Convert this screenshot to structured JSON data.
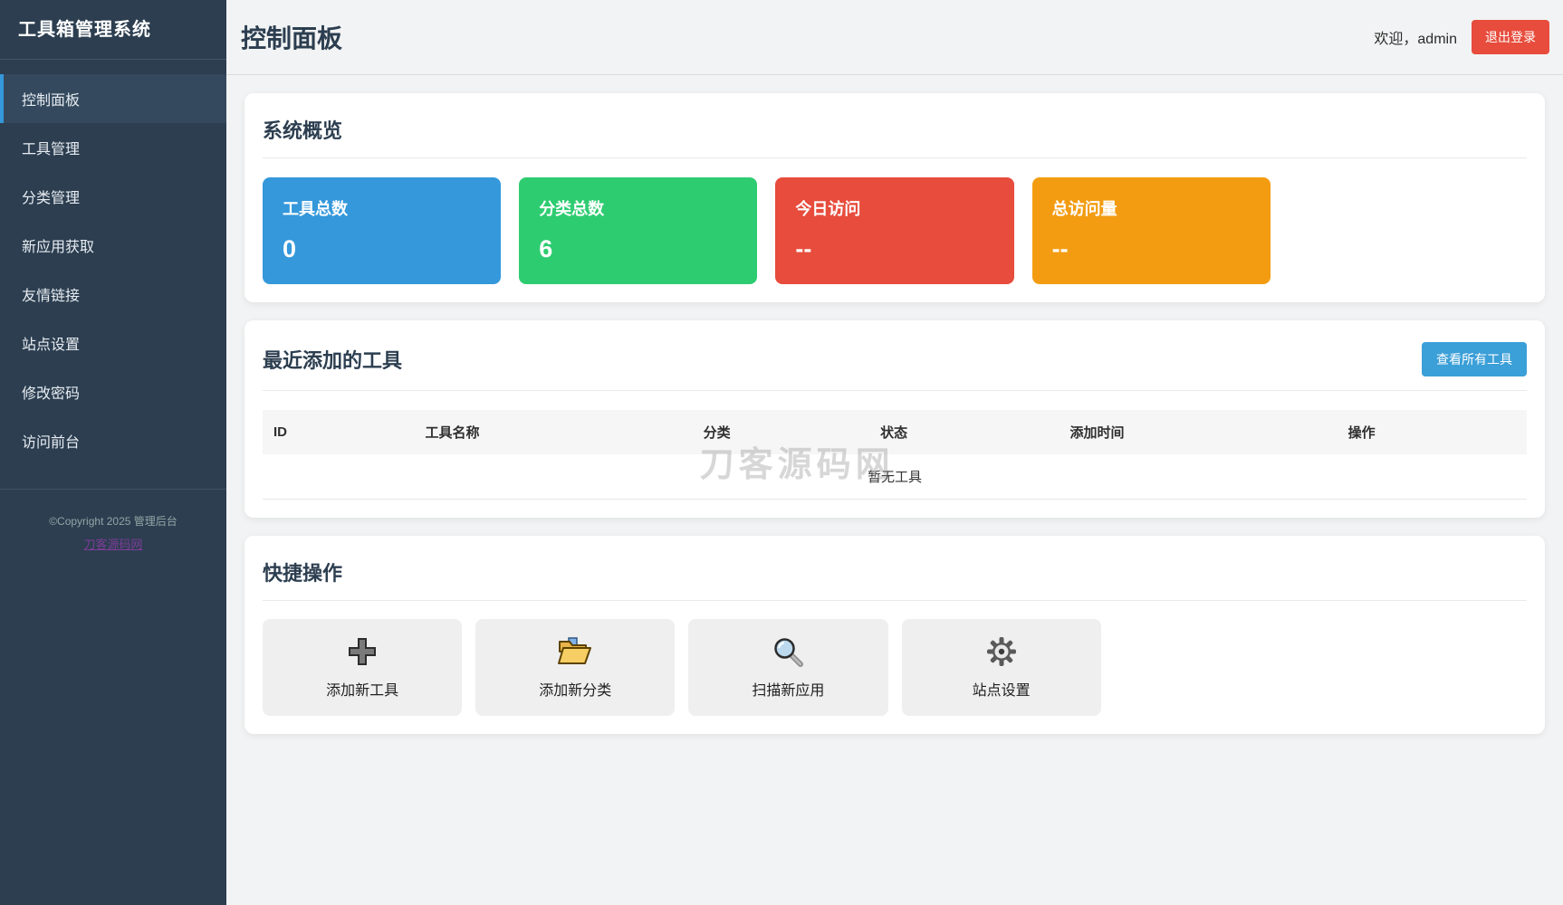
{
  "app": {
    "title": "工具箱管理系统"
  },
  "sidebar": {
    "items": [
      {
        "label": "控制面板",
        "active": true
      },
      {
        "label": "工具管理",
        "active": false
      },
      {
        "label": "分类管理",
        "active": false
      },
      {
        "label": "新应用获取",
        "active": false
      },
      {
        "label": "友情链接",
        "active": false
      },
      {
        "label": "站点设置",
        "active": false
      },
      {
        "label": "修改密码",
        "active": false
      },
      {
        "label": "访问前台",
        "active": false
      }
    ],
    "copyright": "©Copyright 2025 管理后台",
    "footer_link": "刀客源码网"
  },
  "header": {
    "page_title": "控制面板",
    "welcome": "欢迎，admin",
    "logout_label": "退出登录"
  },
  "overview": {
    "title": "系统概览",
    "cards": [
      {
        "label": "工具总数",
        "value": "0",
        "color": "#3498db"
      },
      {
        "label": "分类总数",
        "value": "6",
        "color": "#2ecc71"
      },
      {
        "label": "今日访问",
        "value": "--",
        "color": "#e74c3c"
      },
      {
        "label": "总访问量",
        "value": "--",
        "color": "#f39c12"
      }
    ]
  },
  "recent_tools": {
    "title": "最近添加的工具",
    "view_all_label": "查看所有工具",
    "columns": [
      "ID",
      "工具名称",
      "分类",
      "状态",
      "添加时间",
      "操作"
    ],
    "rows": [],
    "empty_text": "暂无工具"
  },
  "watermark": {
    "text": "刀客源码网"
  },
  "quick_actions": {
    "title": "快捷操作",
    "items": [
      {
        "icon": "plus-icon",
        "label": "添加新工具"
      },
      {
        "icon": "folder-icon",
        "label": "添加新分类"
      },
      {
        "icon": "search-icon",
        "label": "扫描新应用"
      },
      {
        "icon": "gear-icon",
        "label": "站点设置"
      }
    ]
  },
  "colors": {
    "sidebar_bg": "#2c3e50",
    "sidebar_active": "#34495e",
    "accent_blue": "#3498db",
    "accent_green": "#2ecc71",
    "accent_red": "#e74c3c",
    "accent_orange": "#f39c12"
  }
}
